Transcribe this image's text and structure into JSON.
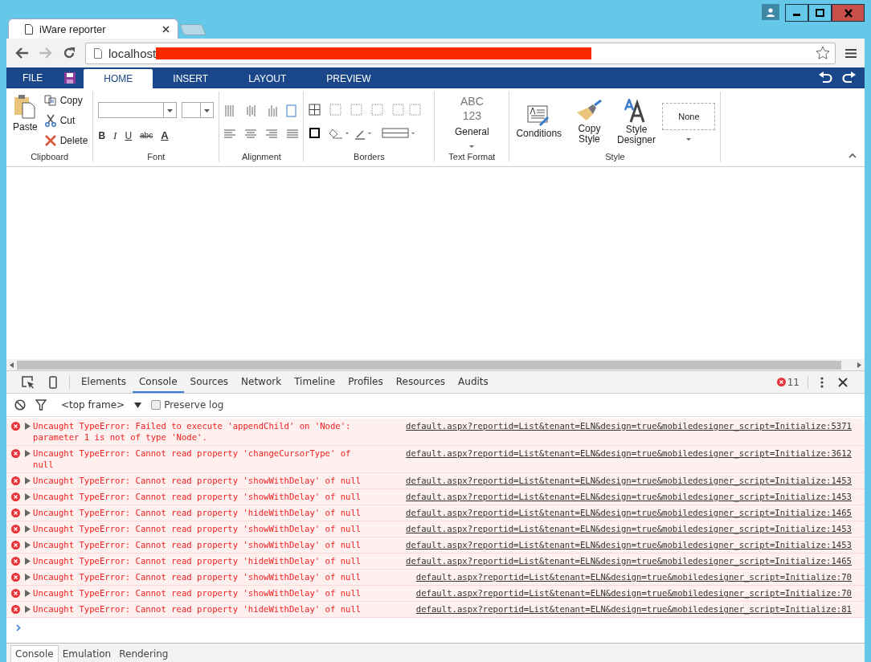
{
  "browser": {
    "tab_title": "iWare reporter",
    "address": "localhost"
  },
  "app_bar": {
    "file": "FILE",
    "tabs": [
      {
        "label": "HOME",
        "selected": true
      },
      {
        "label": "INSERT",
        "selected": false
      },
      {
        "label": "LAYOUT",
        "selected": false
      },
      {
        "label": "PREVIEW",
        "selected": false
      }
    ]
  },
  "ribbon": {
    "clipboard": {
      "label": "Clipboard",
      "paste": "Paste",
      "items": [
        {
          "kind": "copy",
          "label": "Copy"
        },
        {
          "kind": "cut",
          "label": "Cut"
        },
        {
          "kind": "delete",
          "label": "Delete"
        }
      ]
    },
    "font": {
      "label": "Font",
      "format_buttons": [
        {
          "kind": "bold",
          "label": "B"
        },
        {
          "kind": "italic",
          "label": "I"
        },
        {
          "kind": "underline",
          "label": "U"
        },
        {
          "kind": "strike",
          "label": "abc"
        },
        {
          "kind": "color",
          "label": "A"
        }
      ]
    },
    "alignment": {
      "label": "Alignment"
    },
    "borders": {
      "label": "Borders"
    },
    "text_format": {
      "label": "Text Format",
      "sample": [
        "ABC",
        "123"
      ],
      "value": "General"
    },
    "style": {
      "label": "Style",
      "buttons": [
        {
          "kind": "conditions",
          "label": "Conditions"
        },
        {
          "kind": "copy_style",
          "label": "Copy Style"
        },
        {
          "kind": "designer",
          "label": "Style Designer"
        }
      ],
      "preset": "None"
    }
  },
  "devtools": {
    "tabs": [
      {
        "label": "Elements",
        "selected": false
      },
      {
        "label": "Console",
        "selected": true
      },
      {
        "label": "Sources",
        "selected": false
      },
      {
        "label": "Network",
        "selected": false
      },
      {
        "label": "Timeline",
        "selected": false
      },
      {
        "label": "Profiles",
        "selected": false
      },
      {
        "label": "Resources",
        "selected": false
      },
      {
        "label": "Audits",
        "selected": false
      }
    ],
    "error_count": "11",
    "frame": "<top frame>",
    "preserve_log": {
      "label": "Preserve log",
      "checked": false
    },
    "messages": [
      {
        "text": "Uncaught TypeError: Failed to execute 'appendChild' on 'Node': parameter 1 is not of type 'Node'.",
        "source": "default.aspx?reportid=List&tenant=ELN&design=true&mobiledesigner_script=Initialize:5371"
      },
      {
        "text": "Uncaught TypeError: Cannot read property 'changeCursorType' of null",
        "source": "default.aspx?reportid=List&tenant=ELN&design=true&mobiledesigner_script=Initialize:3612"
      },
      {
        "text": "Uncaught TypeError: Cannot read property 'showWithDelay' of null",
        "source": "default.aspx?reportid=List&tenant=ELN&design=true&mobiledesigner_script=Initialize:1453"
      },
      {
        "text": "Uncaught TypeError: Cannot read property 'showWithDelay' of null",
        "source": "default.aspx?reportid=List&tenant=ELN&design=true&mobiledesigner_script=Initialize:1453"
      },
      {
        "text": "Uncaught TypeError: Cannot read property 'hideWithDelay' of null",
        "source": "default.aspx?reportid=List&tenant=ELN&design=true&mobiledesigner_script=Initialize:1465"
      },
      {
        "text": "Uncaught TypeError: Cannot read property 'showWithDelay' of null",
        "source": "default.aspx?reportid=List&tenant=ELN&design=true&mobiledesigner_script=Initialize:1453"
      },
      {
        "text": "Uncaught TypeError: Cannot read property 'showWithDelay' of null",
        "source": "default.aspx?reportid=List&tenant=ELN&design=true&mobiledesigner_script=Initialize:1453"
      },
      {
        "text": "Uncaught TypeError: Cannot read property 'hideWithDelay' of null",
        "source": "default.aspx?reportid=List&tenant=ELN&design=true&mobiledesigner_script=Initialize:1465"
      },
      {
        "text": "Uncaught TypeError: Cannot read property 'showWithDelay' of null",
        "source": "default.aspx?reportid=List&tenant=ELN&design=true&mobiledesigner_script=Initialize:70"
      },
      {
        "text": "Uncaught TypeError: Cannot read property 'showWithDelay' of null",
        "source": "default.aspx?reportid=List&tenant=ELN&design=true&mobiledesigner_script=Initialize:70"
      },
      {
        "text": "Uncaught TypeError: Cannot read property 'hideWithDelay' of null",
        "source": "default.aspx?reportid=List&tenant=ELN&design=true&mobiledesigner_script=Initialize:81"
      }
    ],
    "drawer_tabs": [
      {
        "label": "Console",
        "selected": true
      },
      {
        "label": "Emulation",
        "selected": false
      },
      {
        "label": "Rendering",
        "selected": false
      }
    ]
  }
}
